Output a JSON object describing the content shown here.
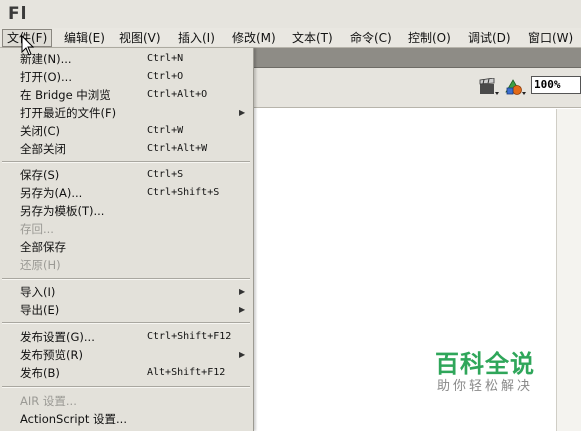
{
  "app": {
    "logo": "Fl"
  },
  "menubar": {
    "items": [
      "文件(F)",
      "编辑(E)",
      "视图(V)",
      "插入(I)",
      "修改(M)",
      "文本(T)",
      "命令(C)",
      "控制(O)",
      "调试(D)",
      "窗口(W)"
    ]
  },
  "toolbar": {
    "zoom": "100%",
    "icons": [
      "clapper-icon",
      "shapes-icon"
    ]
  },
  "file_menu": {
    "items": [
      {
        "label": "新建(N)...",
        "shortcut": "Ctrl+N"
      },
      {
        "label": "打开(O)...",
        "shortcut": "Ctrl+O"
      },
      {
        "label": "在 Bridge 中浏览",
        "shortcut": "Ctrl+Alt+O"
      },
      {
        "label": "打开最近的文件(F)",
        "submenu": true
      },
      {
        "label": "关闭(C)",
        "shortcut": "Ctrl+W"
      },
      {
        "label": "全部关闭",
        "shortcut": "Ctrl+Alt+W"
      },
      {
        "label": "保存(S)",
        "shortcut": "Ctrl+S"
      },
      {
        "label": "另存为(A)...",
        "shortcut": "Ctrl+Shift+S"
      },
      {
        "label": "另存为模板(T)..."
      },
      {
        "label": "存回...",
        "disabled": true
      },
      {
        "label": "全部保存"
      },
      {
        "label": "还原(H)",
        "disabled": true
      },
      {
        "label": "导入(I)",
        "submenu": true
      },
      {
        "label": "导出(E)",
        "submenu": true
      },
      {
        "label": "发布设置(G)...",
        "shortcut": "Ctrl+Shift+F12"
      },
      {
        "label": "发布预览(R)",
        "submenu": true
      },
      {
        "label": "发布(B)",
        "shortcut": "Alt+Shift+F12"
      },
      {
        "label": "AIR 设置...",
        "disabled": true
      },
      {
        "label": "ActionScript 设置..."
      }
    ]
  },
  "watermark": {
    "title": "百科全说",
    "subtitle": "助你轻松解决"
  }
}
